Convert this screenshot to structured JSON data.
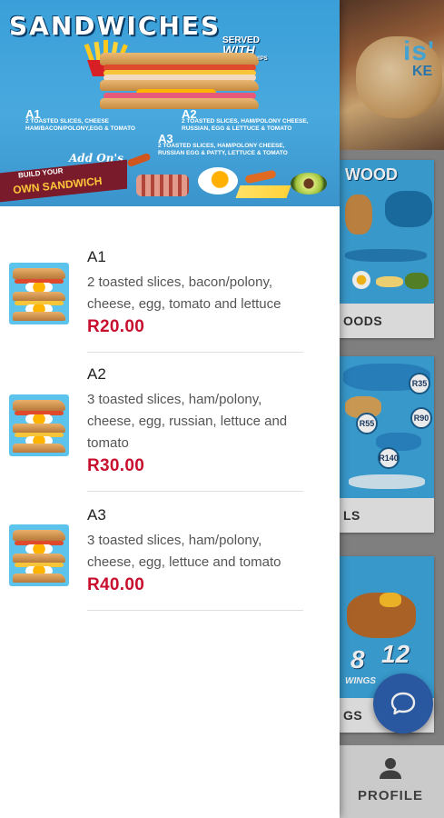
{
  "background": {
    "hero_brand_fragment": "is'",
    "hero_brand_fragment2": "KE",
    "cards": [
      {
        "title_fragment": "WOOD",
        "label_fragment": "OODS"
      },
      {
        "title_fragment": "",
        "label_fragment": "LS"
      },
      {
        "title_fragment": "",
        "label_fragment": "GS"
      }
    ],
    "card2_prices": [
      "R35",
      "R55",
      "R90",
      "R140"
    ],
    "card3_numbers": [
      "8",
      "12"
    ],
    "card3_wings_fragment": "WINGS",
    "nav": {
      "profile_label": "PROFILE",
      "profile_icon": "person-icon"
    },
    "chat_icon": "chat-bubble-icon"
  },
  "drawer": {
    "banner": {
      "title": "SANDWICHES",
      "served_with": [
        "SERVED",
        "WITH",
        "REGULAR CHIPS"
      ],
      "options": [
        {
          "code": "A1",
          "desc": "2 TOASTED SLICES, CHEESE HAM/BACON/POLONY,EGG & TOMATO"
        },
        {
          "code": "A2",
          "desc": "2 TOASTED SLICES, HAM/POLONY CHEESE, RUSSIAN, EGG & LETTUCE & TOMATO"
        },
        {
          "code": "A3",
          "desc": "2 TOASTED SLICES, HAM/POLONY CHEESE, RUSSIAN EGG & PATTY, LETTUCE & TOMATO"
        }
      ],
      "addons_label": "Add On's",
      "build_line1": "BUILD YOUR",
      "build_line2": "OWN SANDWICH"
    },
    "items": [
      {
        "name": "A1",
        "description": "2 toasted slices, bacon/polony, cheese, egg, tomato and lettuce",
        "price": "R20.00"
      },
      {
        "name": "A2",
        "description": "3 toasted slices, ham/polony, cheese, egg, russian, lettuce and tomato",
        "price": "R30.00"
      },
      {
        "name": "A3",
        "description": "3 toasted slices, ham/polony, cheese, egg, lettuce and tomato",
        "price": "R40.00"
      }
    ]
  },
  "colors": {
    "price_red": "#c8102e",
    "banner_blue": "#3a9fd8",
    "fab_blue": "#2d5fae"
  }
}
